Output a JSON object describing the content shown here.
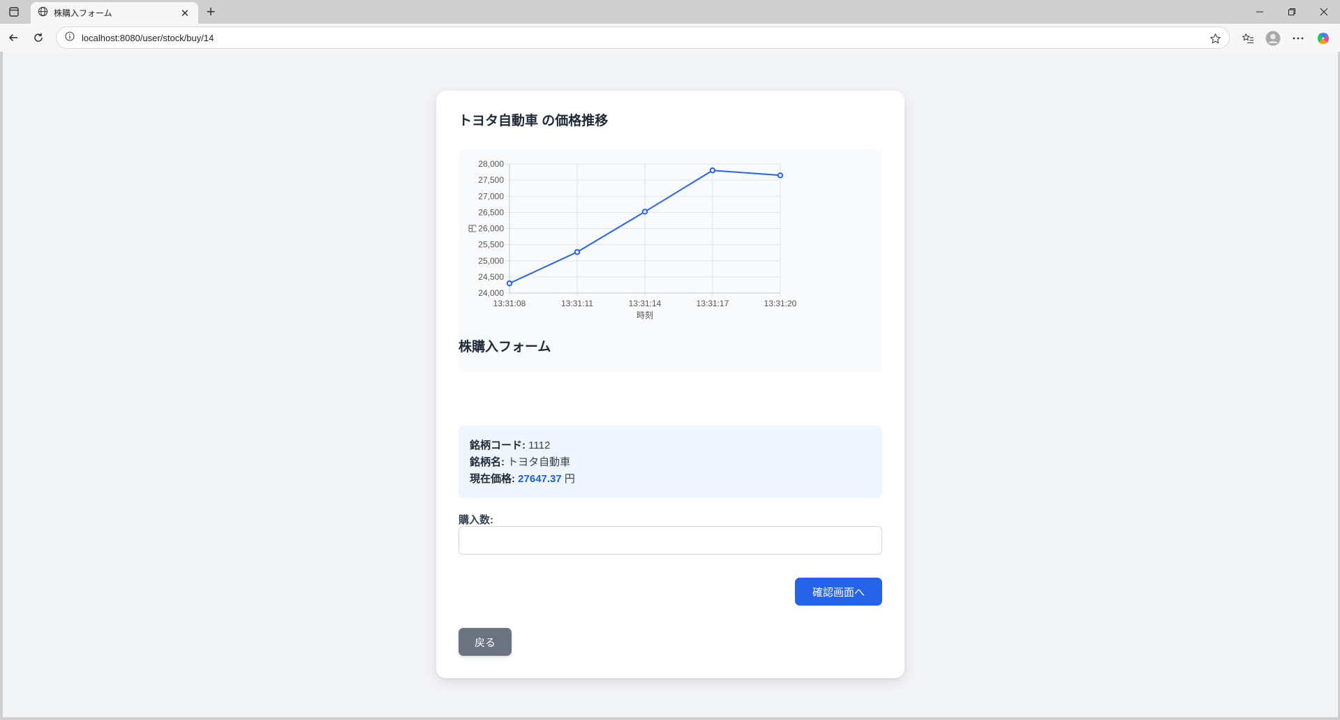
{
  "browser": {
    "tab_title": "株購入フォーム",
    "url": "localhost:8080/user/stock/buy/14"
  },
  "page": {
    "chart_heading": "トヨタ自動車 の価格推移",
    "form_heading": "株購入フォーム",
    "info": {
      "code_label": "銘柄コード:",
      "code_value": "1112",
      "name_label": "銘柄名:",
      "name_value": "トヨタ自動車",
      "price_label": "現在価格:",
      "price_value": "27647.37",
      "price_unit": "円"
    },
    "quantity_label": "購入数:",
    "quantity_value": "",
    "confirm_button": "確認画面へ",
    "back_button": "戻る"
  },
  "colors": {
    "line": "#2563eb",
    "primary_button": "#2563eb",
    "secondary_button": "#6b7280"
  },
  "chart_data": {
    "type": "line",
    "x": [
      "13:31:08",
      "13:31:11",
      "13:31:14",
      "13:31:17",
      "13:31:20"
    ],
    "series": [
      {
        "values": [
          24300,
          25270,
          26520,
          27800,
          27647.37
        ]
      }
    ],
    "xlabel": "時刻",
    "ylabel": "円",
    "ylim": [
      24000,
      28000
    ],
    "yticks": [
      24000,
      24500,
      25000,
      25500,
      26000,
      26500,
      27000,
      27500,
      28000
    ],
    "grid": true,
    "legend": "none"
  }
}
